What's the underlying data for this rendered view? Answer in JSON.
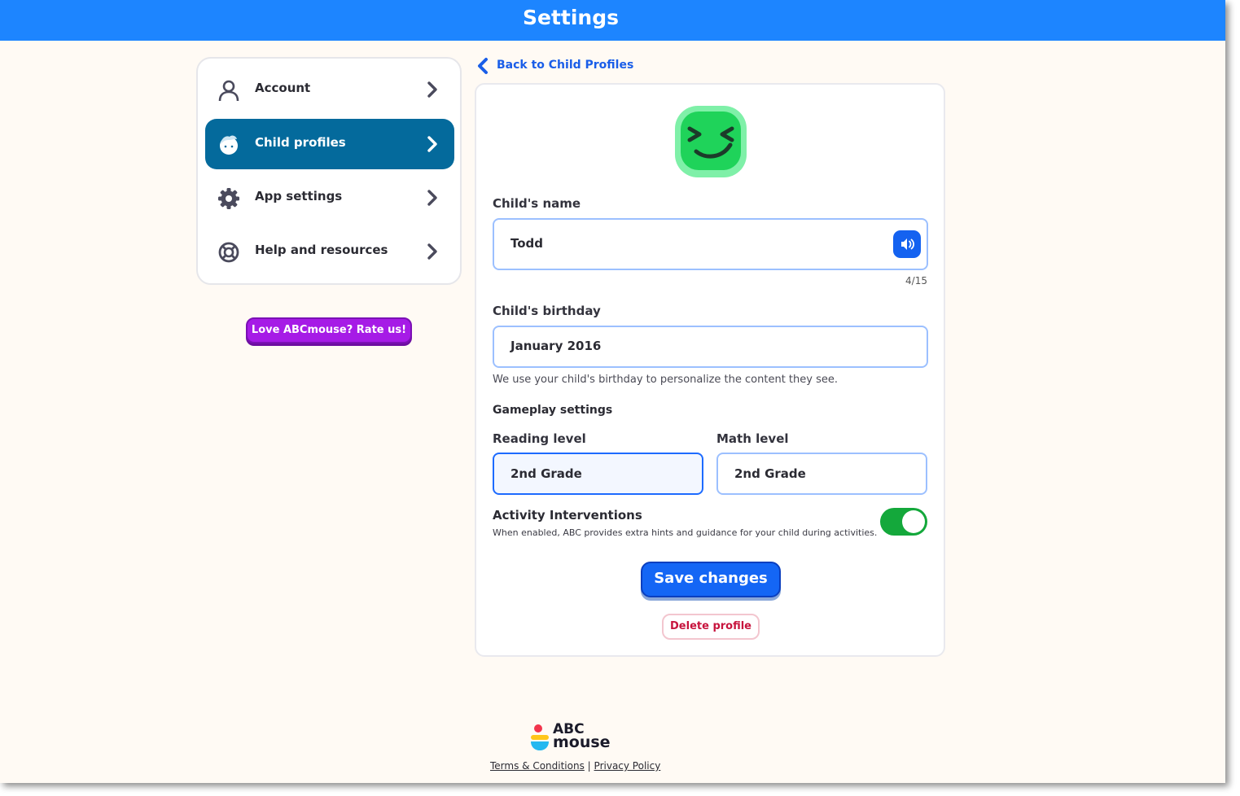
{
  "header": {
    "title": "Settings"
  },
  "sidebar": {
    "items": [
      {
        "label": "Account",
        "icon": "user-icon",
        "active": false
      },
      {
        "label": "Child profiles",
        "icon": "child-face-icon",
        "active": true
      },
      {
        "label": "App settings",
        "icon": "gear-icon",
        "active": false
      },
      {
        "label": "Help and resources",
        "icon": "lifebuoy-icon",
        "active": false
      }
    ],
    "rate_label": "Love ABCmouse? Rate us!"
  },
  "back_link": {
    "label": "Back to Child Profiles",
    "icon": "chevron-left-icon"
  },
  "profile": {
    "avatar_icon": "winking-face-avatar-icon",
    "name_label": "Child's name",
    "name_value": "Todd",
    "name_counter": "4/15",
    "speaker_icon": "speaker-icon",
    "birthday_label": "Child's birthday",
    "birthday_value": "January 2016",
    "birthday_help": "We use your child's birthday to personalize the content they see.",
    "gameplay_title": "Gameplay settings",
    "reading_label": "Reading level",
    "reading_value": "2nd Grade",
    "math_label": "Math level",
    "math_value": "2nd Grade",
    "interventions_title": "Activity Interventions",
    "interventions_desc": "When enabled, ABC provides extra hints and guidance for your child during activities.",
    "interventions_enabled": true,
    "save_label": "Save changes",
    "delete_label": "Delete profile"
  },
  "footer": {
    "logo_line1": "ABC",
    "logo_line2": "mouse",
    "terms_label": "Terms & Conditions",
    "separator": "|",
    "privacy_label": "Privacy Policy"
  },
  "colors": {
    "header_blue": "#1d85ff",
    "active_item": "#046a9c",
    "primary_button": "#1466f5",
    "rate_button": "#a61be6",
    "toggle_on": "#14a83b",
    "delete_text": "#c7143d",
    "avatar_green": "#1fd35a"
  }
}
